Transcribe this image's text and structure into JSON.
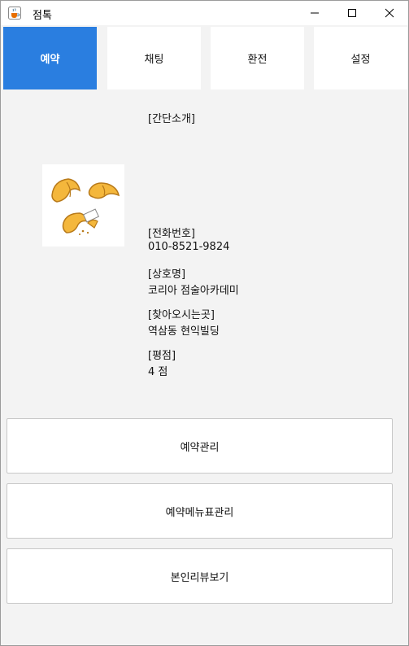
{
  "window": {
    "title": "점톡"
  },
  "tabs": [
    {
      "label": "예약",
      "active": true
    },
    {
      "label": "채팅",
      "active": false
    },
    {
      "label": "환전",
      "active": false
    },
    {
      "label": "설정",
      "active": false
    }
  ],
  "info": {
    "intro_label": "[간단소개]",
    "phone_label": "[전화번호]",
    "phone_value": "010-8521-9824",
    "name_label": "[상호명]",
    "name_value": "코리아 점술아카데미",
    "location_label": "[찾아오시는곳]",
    "location_value": "역삼동 현익빌딩",
    "rating_label": "[평점]",
    "rating_value": "4 점"
  },
  "actions": {
    "reservation_manage": "예약관리",
    "menu_price_manage": "예약메뉴표관리",
    "view_reviews": "본인리뷰보기"
  },
  "colors": {
    "accent": "#2a7ee0",
    "background": "#f3f3f3"
  }
}
